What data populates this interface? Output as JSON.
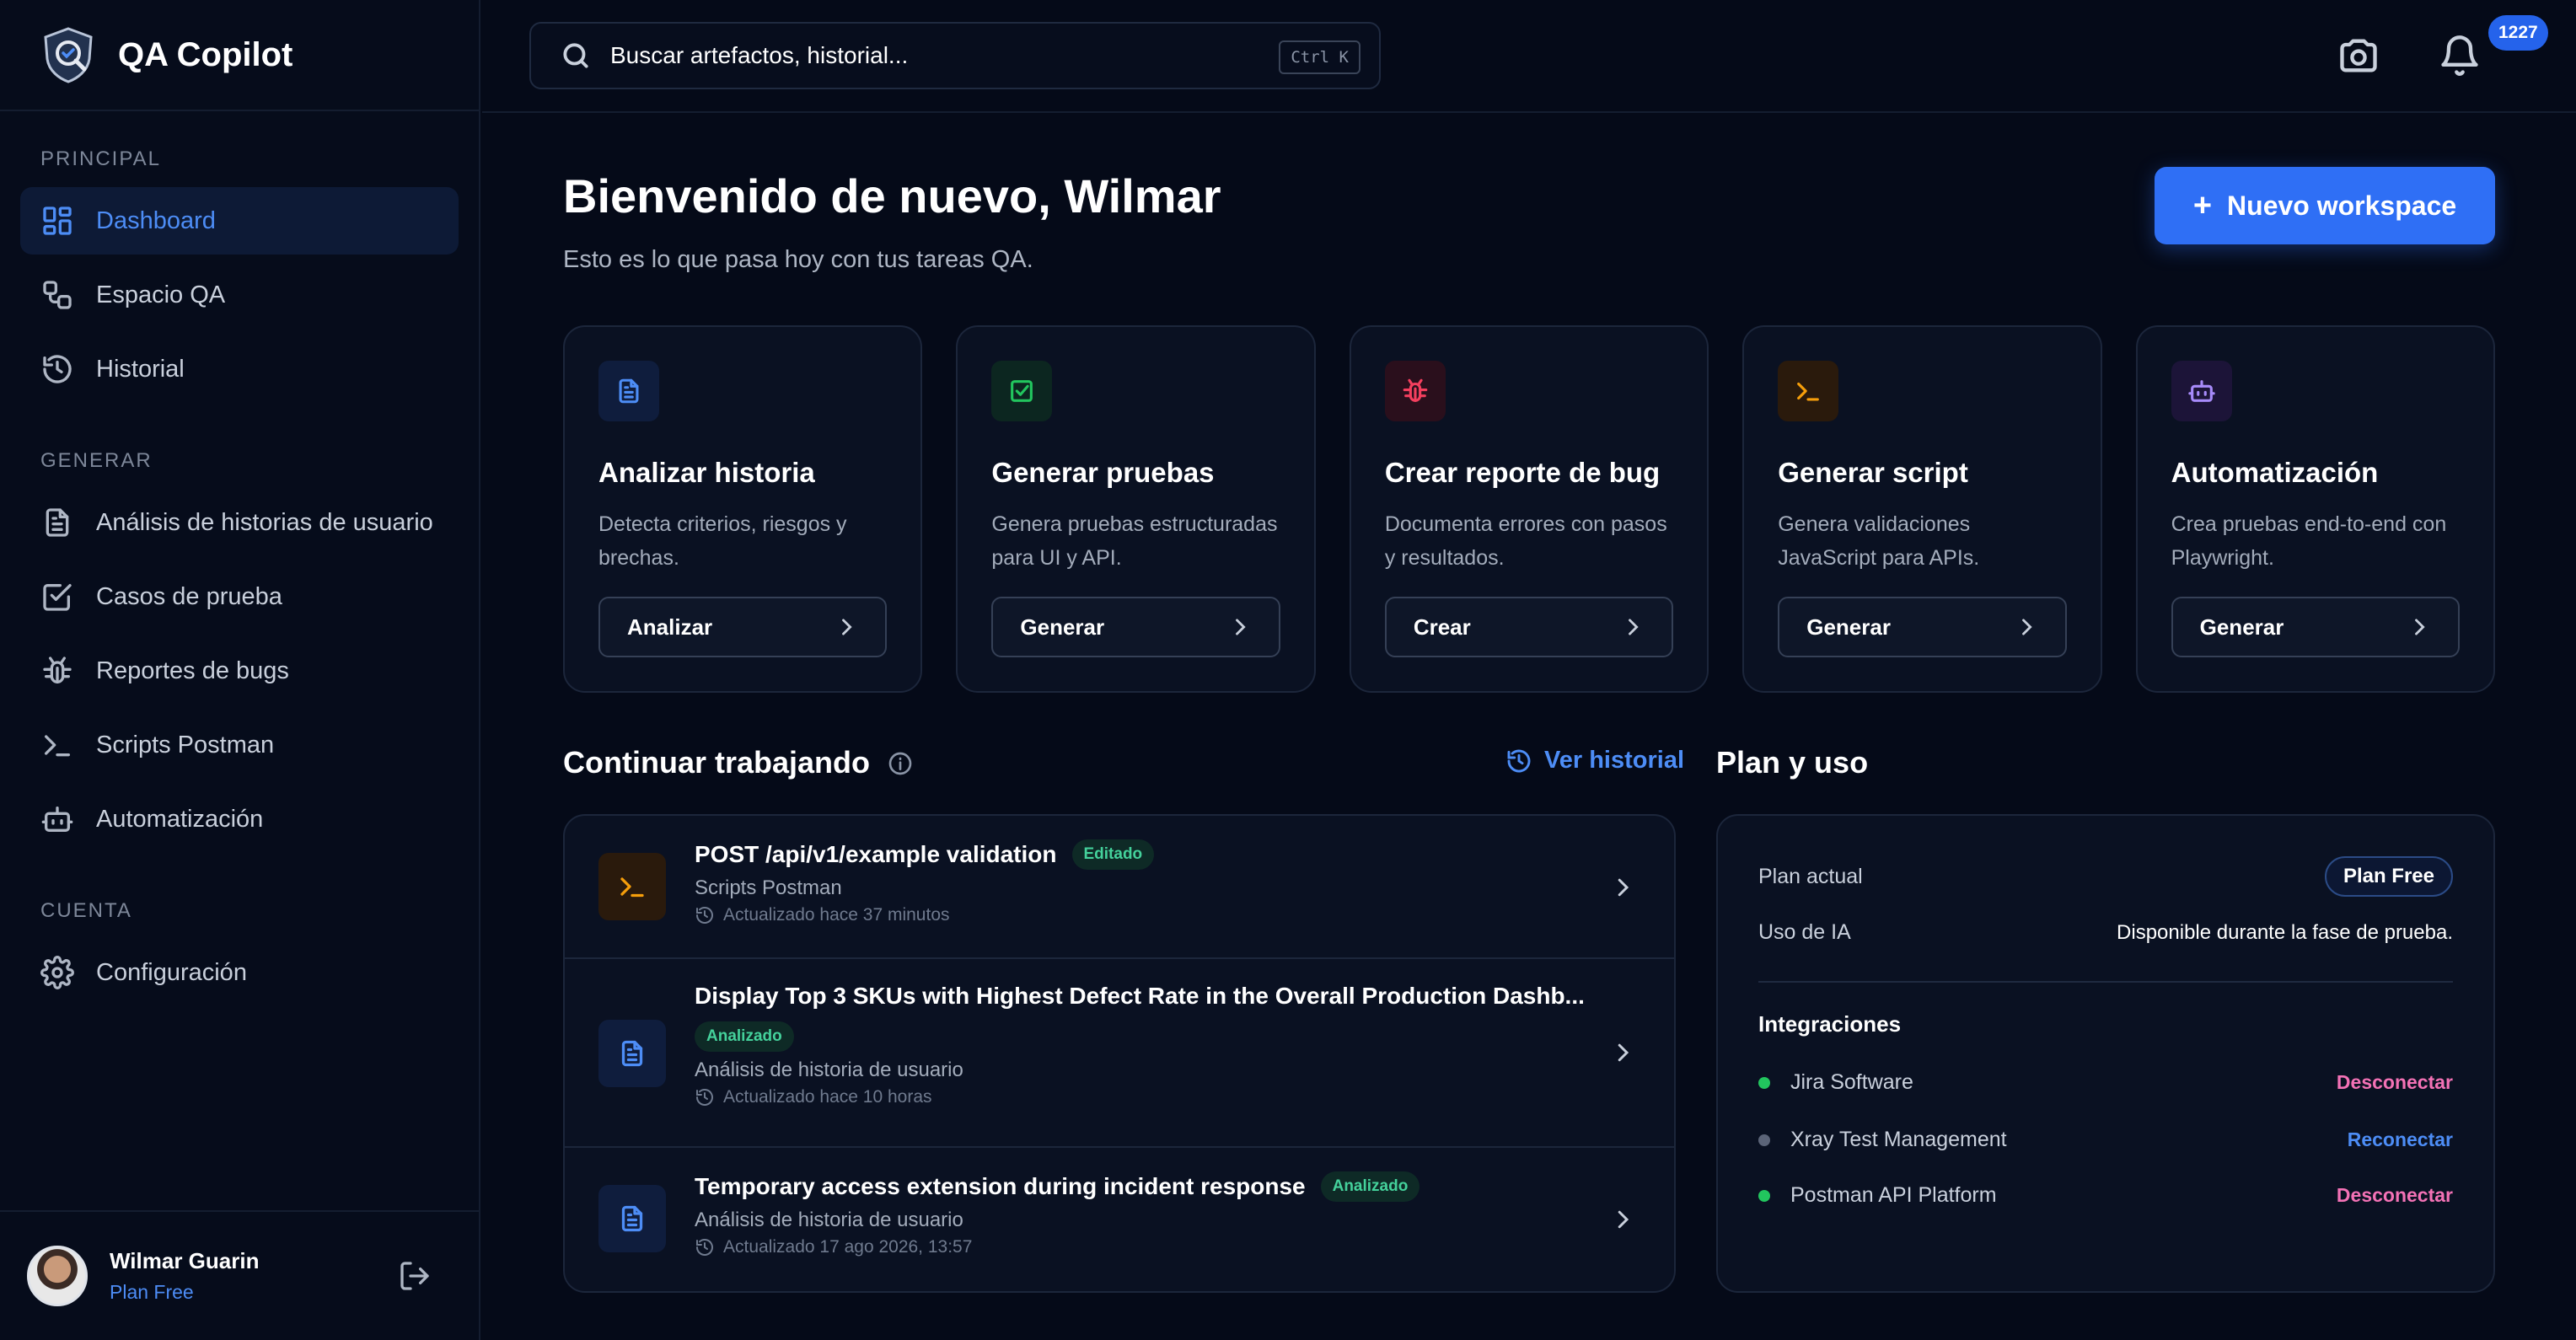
{
  "app": {
    "name": "QA Copilot"
  },
  "sidebar": {
    "sections": [
      {
        "label": "PRINCIPAL"
      },
      {
        "label": "GENERAR"
      },
      {
        "label": "CUENTA"
      }
    ],
    "items": [
      {
        "label": "Dashboard",
        "icon": "dashboard-icon"
      },
      {
        "label": "Espacio QA",
        "icon": "workspace-icon"
      },
      {
        "label": "Historial",
        "icon": "history-icon"
      },
      {
        "label": "Análisis de historias de usuario",
        "icon": "document-icon"
      },
      {
        "label": "Casos de prueba",
        "icon": "checkbox-icon"
      },
      {
        "label": "Reportes de bugs",
        "icon": "bug-icon"
      },
      {
        "label": "Scripts Postman",
        "icon": "terminal-icon"
      },
      {
        "label": "Automatización",
        "icon": "bot-icon"
      },
      {
        "label": "Configuración",
        "icon": "gear-icon"
      }
    ],
    "user": {
      "name": "Wilmar Guarin",
      "plan": "Plan Free"
    }
  },
  "topbar": {
    "search_placeholder": "Buscar artefactos, historial...",
    "shortcut": "Ctrl K",
    "notification_count": "1227"
  },
  "main": {
    "welcome": "Bienvenido de nuevo, Wilmar",
    "subtitle": "Esto es lo que pasa hoy con tus tareas QA.",
    "new_button_plus": "+",
    "new_button": "Nuevo workspace"
  },
  "cards": [
    {
      "title": "Analizar historia",
      "desc": "Detecta criterios, riesgos y brechas.",
      "button": "Analizar",
      "icon": "document-icon",
      "color": "#4d8df6",
      "bg": "#0f1d3d"
    },
    {
      "title": "Generar pruebas",
      "desc": "Genera pruebas estructuradas para UI y API.",
      "button": "Generar",
      "icon": "checkbox-icon",
      "color": "#22c55e",
      "bg": "#0c2620"
    },
    {
      "title": "Crear reporte de bug",
      "desc": "Documenta errores con pasos y resultados.",
      "button": "Crear",
      "icon": "bug-icon",
      "color": "#f43f5e",
      "bg": "#2a0f1c"
    },
    {
      "title": "Generar script",
      "desc": "Genera validaciones JavaScript para APIs.",
      "button": "Generar",
      "icon": "terminal-icon",
      "color": "#f59e0b",
      "bg": "#2a1a0c"
    },
    {
      "title": "Automatización",
      "desc": "Crea pruebas end-to-end con Playwright.",
      "button": "Generar",
      "icon": "bot-icon",
      "color": "#a78bfa",
      "bg": "#1c1438"
    }
  ],
  "continue": {
    "title": "Continuar trabajando",
    "history_link": "Ver historial",
    "items": [
      {
        "title": "POST /api/v1/example validation",
        "status": "Editado",
        "category": "Scripts Postman",
        "time": "Actualizado hace 37 minutos",
        "icon": "terminal-icon"
      },
      {
        "title": "Display Top 3 SKUs with Highest Defect Rate in the Overall Production Dashb...",
        "status": "Analizado",
        "category": "Análisis de historia de usuario",
        "time": "Actualizado hace 10 horas",
        "icon": "document-icon"
      },
      {
        "title": "Temporary access extension during incident response",
        "status": "Analizado",
        "category": "Análisis de historia de usuario",
        "time": "Actualizado 17 ago 2026, 13:57",
        "icon": "document-icon"
      }
    ]
  },
  "plan": {
    "title": "Plan y uso",
    "current_label": "Plan actual",
    "current_value": "Plan Free",
    "usage_label": "Uso de IA",
    "usage_value": "Disponible durante la fase de prueba.",
    "integrations_title": "Integraciones",
    "integrations": [
      {
        "name": "Jira Software",
        "action": "Desconectar",
        "status_color": "#22c55e",
        "action_color": "#f472b6"
      },
      {
        "name": "Xray Test Management",
        "action": "Reconectar",
        "status_color": "#5b6478",
        "action_color": "#4d8df6"
      },
      {
        "name": "Postman API Platform",
        "action": "Desconectar",
        "status_color": "#22c55e",
        "action_color": "#f472b6"
      }
    ]
  }
}
